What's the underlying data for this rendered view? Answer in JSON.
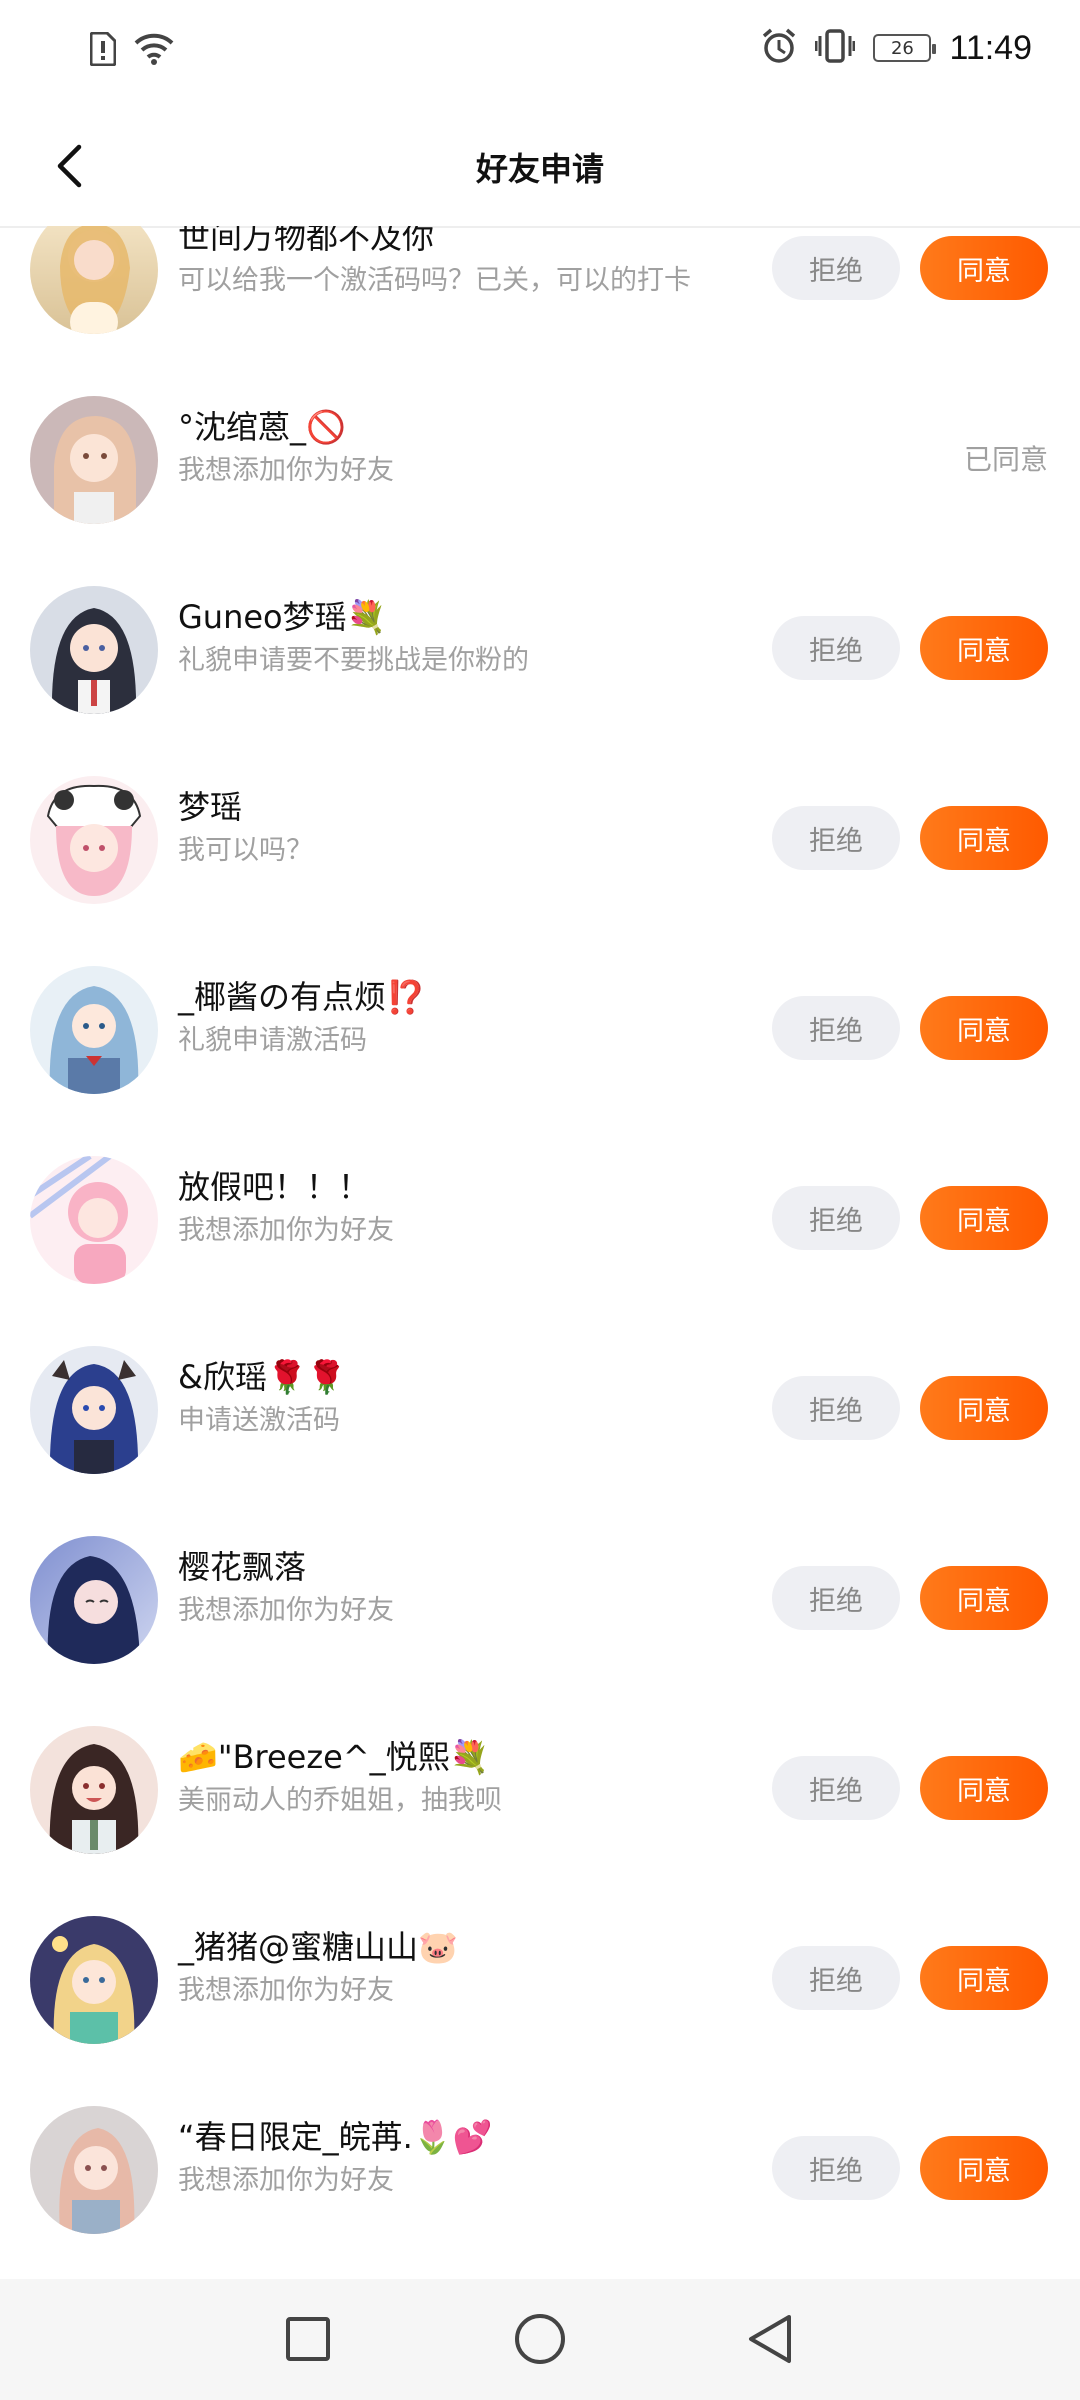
{
  "status_bar": {
    "time": "11:49",
    "battery_level": "26",
    "icons": [
      "alert-icon",
      "wifi-icon",
      "alarm-icon",
      "vibrate-icon",
      "battery-icon"
    ]
  },
  "header": {
    "title": "好友申请",
    "back_icon": "back-arrow-icon"
  },
  "buttons": {
    "reject_label": "拒绝",
    "accept_label": "同意",
    "accepted_label": "已同意"
  },
  "colors": {
    "accent": "#ff6a10",
    "reject_bg": "#eeeff3",
    "muted_text": "#a0a0a0"
  },
  "requests": [
    {
      "name": "世间万物都不及你",
      "message": "可以给我一个激活码吗？已关，可以的打卡",
      "status": "pending"
    },
    {
      "name": "°沈绾蒽_🚫",
      "message": "我想添加你为好友",
      "status": "accepted"
    },
    {
      "name": "Guneo梦瑶💐",
      "message": "礼貌申请要不要挑战是你粉的",
      "status": "pending"
    },
    {
      "name": "梦瑶",
      "message": "我可以吗？",
      "status": "pending"
    },
    {
      "name": "_椰酱の有点烦⁉️",
      "message": "礼貌申请激活码",
      "status": "pending"
    },
    {
      "name": "放假吧！！！",
      "message": "我想添加你为好友",
      "status": "pending"
    },
    {
      "name": "&欣瑶🌹🌹",
      "message": "申请送激活码",
      "status": "pending"
    },
    {
      "name": "樱花飘落",
      "message": "我想添加你为好友",
      "status": "pending"
    },
    {
      "name": "🧀\"Breeze^_悦熙💐",
      "message": "美丽动人的乔姐姐，抽我呗",
      "status": "pending"
    },
    {
      "name": "_猪猪@蜜糖山山🐷",
      "message": "我想添加你为好友",
      "status": "pending"
    },
    {
      "name": "“春日限定_皖苒.🌷💕",
      "message": "我想添加你为好友",
      "status": "pending"
    }
  ],
  "nav_bar": {
    "icons": [
      "recent-apps-icon",
      "home-icon",
      "back-icon"
    ]
  }
}
